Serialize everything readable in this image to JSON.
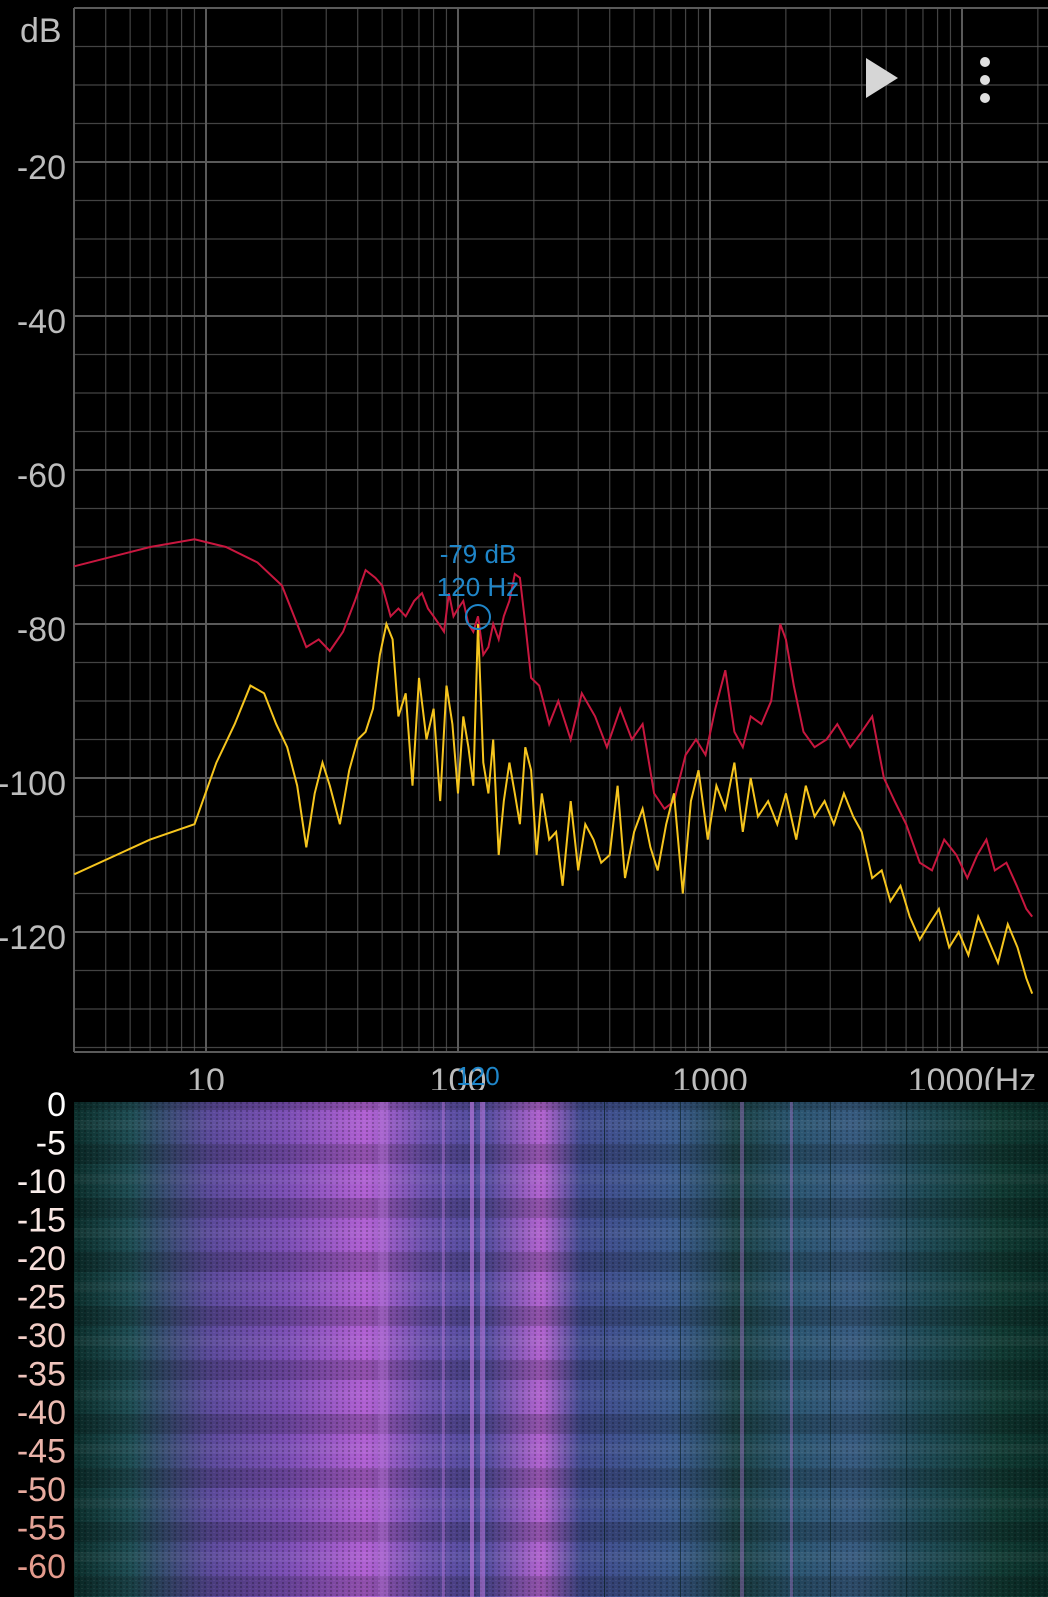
{
  "toolbar": {
    "play_icon": "play-icon",
    "menu_icon": "more-vertical-icon"
  },
  "spectrum": {
    "y_unit": "dB",
    "y_ticks": [
      "-20",
      "-40",
      "-60",
      "-80",
      "-100",
      "-120"
    ],
    "x_ticks": [
      "10",
      "100",
      "1000",
      "1000(Hz"
    ],
    "marker": {
      "db_label": "-79 dB",
      "hz_label": "120 Hz",
      "axis_label": "120"
    },
    "colors": {
      "background": "#000000",
      "grid": "#5a5a5a",
      "peak_hold": "#c8173f",
      "live": "#f6c51e",
      "marker": "#1f86c9",
      "axis_text": "#bdbdbd"
    }
  },
  "spectrogram": {
    "y_ticks": [
      "0",
      "-5",
      "-10",
      "-15",
      "-20",
      "-25",
      "-30",
      "-35",
      "-40",
      "-45",
      "-50",
      "-55",
      "-60"
    ],
    "tick_color_top": "#ffffff",
    "tick_color_bottom": "#e39a8c",
    "colors": {
      "low": "#0c2a2a",
      "mid": "#3c4a80",
      "high": "#b05fd0"
    }
  },
  "chart_data": {
    "type": "line",
    "title": "",
    "xlabel": "(Hz",
    "ylabel": "dB",
    "x_scale": "log",
    "xlim": [
      3,
      19000
    ],
    "ylim": [
      -136,
      0
    ],
    "series": [
      {
        "x": [
          3,
          6,
          9,
          12,
          16,
          20,
          25,
          28,
          31,
          35,
          39,
          43,
          47,
          50,
          54,
          58,
          62,
          67,
          72,
          76,
          80,
          84,
          88,
          92,
          96,
          100,
          105,
          110,
          115,
          120,
          126,
          132,
          138,
          145,
          152,
          160,
          168,
          176,
          185,
          195,
          210,
          230,
          250,
          280,
          310,
          350,
          390,
          440,
          490,
          540,
          600,
          660,
          720,
          800,
          880,
          960,
          1050,
          1150,
          1250,
          1350,
          1450,
          1600,
          1750,
          1900,
          2000,
          2150,
          2350,
          2600,
          2900,
          3200,
          3600,
          4000,
          4400,
          4900,
          5400,
          6000,
          6800,
          7600,
          8500,
          9500,
          10500,
          11500,
          12500,
          13500,
          15000,
          16500,
          18000,
          19000
        ],
        "y": [
          -72.5,
          -70,
          -69,
          -70,
          -72,
          -75,
          -83,
          -82,
          -83.5,
          -81,
          -77,
          -73,
          -74,
          -75,
          -79,
          -78,
          -79,
          -77,
          -76,
          -78,
          -79,
          -80,
          -81,
          -76,
          -79,
          -78,
          -77,
          -80,
          -81,
          -79,
          -84,
          -83,
          -80,
          -82,
          -79,
          -77,
          -73.5,
          -74,
          -80,
          -87,
          -88,
          -93,
          -90,
          -95,
          -89,
          -92,
          -96,
          -91,
          -95,
          -93,
          -102,
          -104,
          -103,
          -97,
          -95,
          -97,
          -91,
          -86,
          -94,
          -96,
          -92,
          -93,
          -90,
          -80,
          -82,
          -88,
          -94,
          -96,
          -95,
          -93,
          -96,
          -94,
          -92,
          -100,
          -103,
          -106,
          -111,
          -112,
          -108,
          -110,
          -113,
          -110,
          -108,
          -112,
          -111,
          -114,
          -117,
          -118
        ]
      },
      {
        "x": [
          3,
          6,
          9,
          11,
          13,
          15,
          17,
          19,
          21,
          23,
          25,
          27,
          29,
          31,
          34,
          37,
          40,
          43,
          46,
          49,
          52,
          55,
          58,
          62,
          66,
          70,
          75,
          80,
          85,
          90,
          95,
          100,
          105,
          110,
          115,
          120,
          126,
          132,
          138,
          145,
          152,
          160,
          168,
          176,
          185,
          195,
          205,
          215,
          230,
          245,
          260,
          280,
          300,
          320,
          345,
          370,
          400,
          430,
          460,
          500,
          540,
          580,
          620,
          670,
          720,
          780,
          840,
          900,
          980,
          1060,
          1150,
          1250,
          1350,
          1450,
          1550,
          1700,
          1850,
          2000,
          2200,
          2400,
          2600,
          2850,
          3100,
          3400,
          3700,
          4000,
          4400,
          4800,
          5200,
          5700,
          6200,
          6800,
          7400,
          8100,
          8900,
          9700,
          10600,
          11600,
          12700,
          13900,
          15200,
          16600,
          18000,
          19000
        ],
        "y": [
          -112.5,
          -108,
          -106,
          -98,
          -93,
          -88,
          -89,
          -93,
          -96,
          -101,
          -109,
          -102,
          -98,
          -101,
          -106,
          -99,
          -95,
          -94,
          -91,
          -84,
          -80,
          -82,
          -92,
          -89,
          -101,
          -87,
          -95,
          -91,
          -103,
          -88,
          -93,
          -102,
          -92,
          -96,
          -101,
          -80,
          -98,
          -102,
          -95,
          -110,
          -103,
          -98,
          -102,
          -106,
          -96,
          -99,
          -110,
          -102,
          -108,
          -107,
          -114,
          -103,
          -112,
          -106,
          -108,
          -111,
          -110,
          -101,
          -113,
          -107,
          -104,
          -109,
          -112,
          -106,
          -102,
          -115,
          -103,
          -99,
          -108,
          -101,
          -104,
          -98,
          -107,
          -100,
          -105,
          -103,
          -106,
          -102,
          -108,
          -101,
          -105,
          -103,
          -106,
          -102,
          -105,
          -107,
          -113,
          -112,
          -116,
          -114,
          -118,
          -121,
          -119,
          -117,
          -122,
          -120,
          -123,
          -118,
          -121,
          -124,
          -119,
          -122,
          -126,
          -128
        ]
      }
    ]
  }
}
